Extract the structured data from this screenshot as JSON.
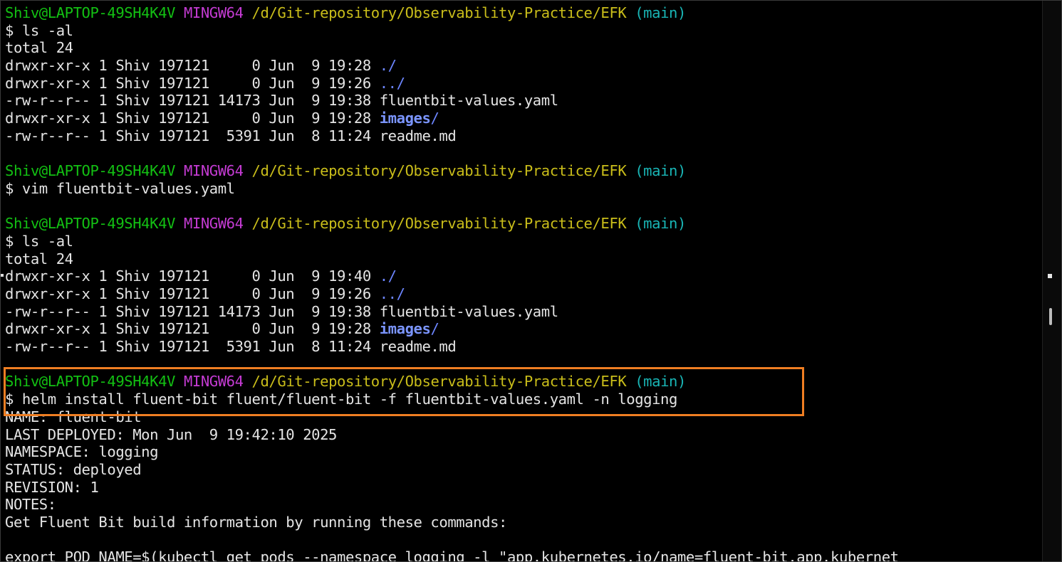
{
  "prompt": {
    "user": "Shiv@LAPTOP-49SH4K4V",
    "system": "MINGW64",
    "path": "/d/Git-repository/Observability-Practice/EFK",
    "branch": "(main)"
  },
  "lines": [
    {
      "type": "prompt"
    },
    {
      "type": "text",
      "text": "$ ls -al"
    },
    {
      "type": "text",
      "text": "total 24"
    },
    {
      "type": "ls",
      "meta": "drwxr-xr-x 1 Shiv 197121     0 Jun  9 19:28 ",
      "name": "./",
      "kind": "dir"
    },
    {
      "type": "ls",
      "meta": "drwxr-xr-x 1 Shiv 197121     0 Jun  9 19:26 ",
      "name": "../",
      "kind": "dir"
    },
    {
      "type": "ls",
      "meta": "-rw-r--r-- 1 Shiv 197121 14173 Jun  9 19:38 ",
      "name": "fluentbit-values.yaml",
      "kind": "file"
    },
    {
      "type": "ls",
      "meta": "drwxr-xr-x 1 Shiv 197121     0 Jun  9 19:28 ",
      "name": "images",
      "suffix": "/",
      "kind": "dirbold"
    },
    {
      "type": "ls",
      "meta": "-rw-r--r-- 1 Shiv 197121  5391 Jun  8 11:24 ",
      "name": "readme.md",
      "kind": "file"
    },
    {
      "type": "text",
      "text": ""
    },
    {
      "type": "prompt"
    },
    {
      "type": "text",
      "text": "$ vim fluentbit-values.yaml"
    },
    {
      "type": "text",
      "text": ""
    },
    {
      "type": "prompt"
    },
    {
      "type": "text",
      "text": "$ ls -al"
    },
    {
      "type": "text",
      "text": "total 24"
    },
    {
      "type": "ls",
      "meta": "drwxr-xr-x 1 Shiv 197121     0 Jun  9 19:40 ",
      "name": "./",
      "kind": "dir"
    },
    {
      "type": "ls",
      "meta": "drwxr-xr-x 1 Shiv 197121     0 Jun  9 19:26 ",
      "name": "../",
      "kind": "dir"
    },
    {
      "type": "ls",
      "meta": "-rw-r--r-- 1 Shiv 197121 14173 Jun  9 19:38 ",
      "name": "fluentbit-values.yaml",
      "kind": "file"
    },
    {
      "type": "ls",
      "meta": "drwxr-xr-x 1 Shiv 197121     0 Jun  9 19:28 ",
      "name": "images",
      "suffix": "/",
      "kind": "dirbold"
    },
    {
      "type": "ls",
      "meta": "-rw-r--r-- 1 Shiv 197121  5391 Jun  8 11:24 ",
      "name": "readme.md",
      "kind": "file"
    },
    {
      "type": "text",
      "text": ""
    },
    {
      "type": "prompt"
    },
    {
      "type": "text",
      "text": "$ helm install fluent-bit fluent/fluent-bit -f fluentbit-values.yaml -n logging"
    },
    {
      "type": "text",
      "text": "NAME: fluent-bit"
    },
    {
      "type": "text",
      "text": "LAST DEPLOYED: Mon Jun  9 19:42:10 2025"
    },
    {
      "type": "text",
      "text": "NAMESPACE: logging"
    },
    {
      "type": "text",
      "text": "STATUS: deployed"
    },
    {
      "type": "text",
      "text": "REVISION: 1"
    },
    {
      "type": "text",
      "text": "NOTES:"
    },
    {
      "type": "text",
      "text": "Get Fluent Bit build information by running these commands:"
    },
    {
      "type": "text",
      "text": ""
    },
    {
      "type": "text",
      "text": "export POD_NAME=$(kubectl get pods --namespace logging -l \"app.kubernetes.io/name=fluent-bit,app.kubernet"
    }
  ],
  "colors": {
    "background": "#000000",
    "text": "#e4e4e4",
    "user": "#13c013",
    "system": "#c43bd3",
    "path": "#c9bd1a",
    "branch": "#19b5b5",
    "directory": "#6c85ff",
    "highlight": "#ef7e22"
  },
  "icons": {
    "scrollbar": "scrollbar-thumb"
  }
}
